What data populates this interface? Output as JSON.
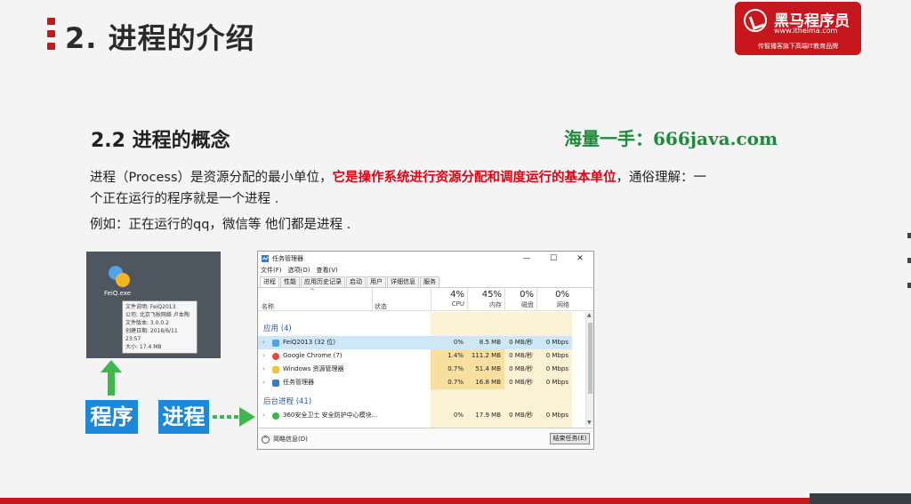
{
  "slide": {
    "title": "2. 进程的介绍",
    "section_heading": "2.2 进程的概念",
    "watermark": "海量一手：666java.com",
    "para1_prefix": "进程（Process）是资源分配的最小单位，",
    "para1_highlight": "它是操作系统进行资源分配和调度运行的基本单位",
    "para1_suffix": "，通俗理解：一",
    "para2": "个正在运行的程序就是一个进程 .",
    "para3": "例如：正在运行的qq，微信等 他们都是进程 ."
  },
  "logo": {
    "name": "黑马程序员",
    "url": "www.itheima.com",
    "slogan": "传智播客旗下高端IT教育品牌"
  },
  "desktop": {
    "icon_label": "FeiQ.exe",
    "tooltip": [
      "文件说明: FeiQ2013",
      "公司: 北京飞秋网络 卢本陶",
      "文件版本: 3.0.0.2",
      "创建日期: 2018/6/11 23:57",
      "大小: 17.4 MB"
    ]
  },
  "tags": {
    "program": "程序",
    "process": "进程"
  },
  "taskmgr": {
    "title": "任务管理器",
    "win_min": "—",
    "win_max": "☐",
    "win_close": "✕",
    "menu": [
      "文件(F)",
      "选项(O)",
      "查看(V)"
    ],
    "tabs": [
      "进程",
      "性能",
      "应用历史记录",
      "启动",
      "用户",
      "详细信息",
      "服务"
    ],
    "sort_glyph": "^",
    "col_name": "名称",
    "col_status": "状态",
    "cpu_pct": "4%",
    "cpu_label": "CPU",
    "mem_pct": "45%",
    "mem_label": "内存",
    "disk_pct": "0%",
    "disk_label": "磁盘",
    "net_pct": "0%",
    "net_label": "网络",
    "section_apps": "应用 (4)",
    "section_bg": "后台进程 (41)",
    "rows": [
      {
        "name": "FeiQ2013 (32 位)",
        "cpu": "0%",
        "mem": "8.5 MB",
        "disk": "0 MB/秒",
        "net": "0 Mbps"
      },
      {
        "name": "Google Chrome (7)",
        "cpu": "1.4%",
        "mem": "111.2 MB",
        "disk": "0 MB/秒",
        "net": "0 Mbps"
      },
      {
        "name": "Windows 资源管理器",
        "cpu": "0.7%",
        "mem": "51.4 MB",
        "disk": "0 MB/秒",
        "net": "0 Mbps"
      },
      {
        "name": "任务管理器",
        "cpu": "0.7%",
        "mem": "16.8 MB",
        "disk": "0 MB/秒",
        "net": "0 Mbps"
      },
      {
        "name": "360安全卫士 安全防护中心模块...",
        "cpu": "0%",
        "mem": "17.9 MB",
        "disk": "0 MB/秒",
        "net": "0 Mbps"
      }
    ],
    "fewer_details": "简略信息(D)",
    "end_task": "结束任务(E)"
  },
  "colors": {
    "brand_red": "#c8161d",
    "highlight_red": "#e60012",
    "tag_blue": "#1e88d8",
    "arrow_green": "#3db84a",
    "watermark_green": "#1d8c3a"
  }
}
